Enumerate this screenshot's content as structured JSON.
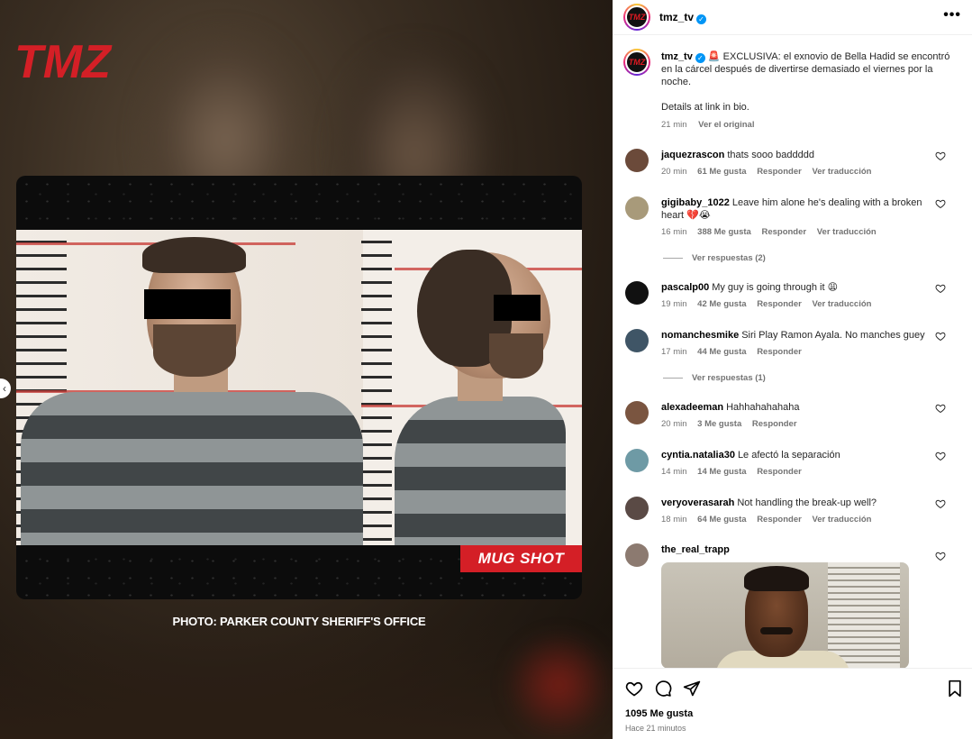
{
  "media": {
    "logo_text": "TMZ",
    "overlay_tag": "MUG SHOT",
    "photo_credit": "PHOTO: PARKER COUNTY SHERIFF'S OFFICE"
  },
  "header": {
    "username": "tmz_tv",
    "avatar_text": "TMZ",
    "more_label": "•••"
  },
  "caption": {
    "username": "tmz_tv",
    "text": "🚨 EXCLUSIVA: el exnovio de Bella Hadid se encontró en la cárcel después de divertirse demasiado el viernes por la noche.",
    "link_text": "Details at link in bio.",
    "time": "21 min",
    "see_original": "Ver el original"
  },
  "comments": [
    {
      "username": "jaquezrascon",
      "text": "thats sooo baddddd",
      "time": "20 min",
      "likes": "61 Me gusta",
      "reply": "Responder",
      "translate": "Ver traducción",
      "avatar_color": "#6b4a3a"
    },
    {
      "username": "gigibaby_1022",
      "text": "Leave him alone he's dealing with a broken heart 💔😭",
      "time": "16 min",
      "likes": "388 Me gusta",
      "reply": "Responder",
      "translate": "Ver traducción",
      "replies": "Ver respuestas (2)",
      "avatar_color": "#a89a7a"
    },
    {
      "username": "pascalp00",
      "text": "My guy is going through it 😩",
      "time": "19 min",
      "likes": "42 Me gusta",
      "reply": "Responder",
      "translate": "Ver traducción",
      "avatar_color": "#111111"
    },
    {
      "username": "nomanchesmike",
      "text": "Siri Play Ramon Ayala. No manches guey",
      "time": "17 min",
      "likes": "44 Me gusta",
      "reply": "Responder",
      "replies": "Ver respuestas (1)",
      "avatar_color": "#3f5566"
    },
    {
      "username": "alexadeeman",
      "text": "Hahhahahahaha",
      "time": "20 min",
      "likes": "3 Me gusta",
      "reply": "Responder",
      "avatar_color": "#7a5540"
    },
    {
      "username": "cyntia.natalia30",
      "text": "Le afectó la separación",
      "time": "14 min",
      "likes": "14 Me gusta",
      "reply": "Responder",
      "avatar_color": "#6e9aa5"
    },
    {
      "username": "veryoverasarah",
      "text": "Not handling the break-up well?",
      "time": "18 min",
      "likes": "64 Me gusta",
      "reply": "Responder",
      "translate": "Ver traducción",
      "avatar_color": "#5a4a45"
    },
    {
      "username": "the_real_trapp",
      "text": "",
      "avatar_color": "#8c7a70"
    }
  ],
  "footer": {
    "likes": "1095 Me gusta",
    "posted": "Hace 21 minutos"
  },
  "colors": {
    "brand_red": "#d41f26",
    "verified_blue": "#0095f6",
    "muted_text": "#737373"
  }
}
